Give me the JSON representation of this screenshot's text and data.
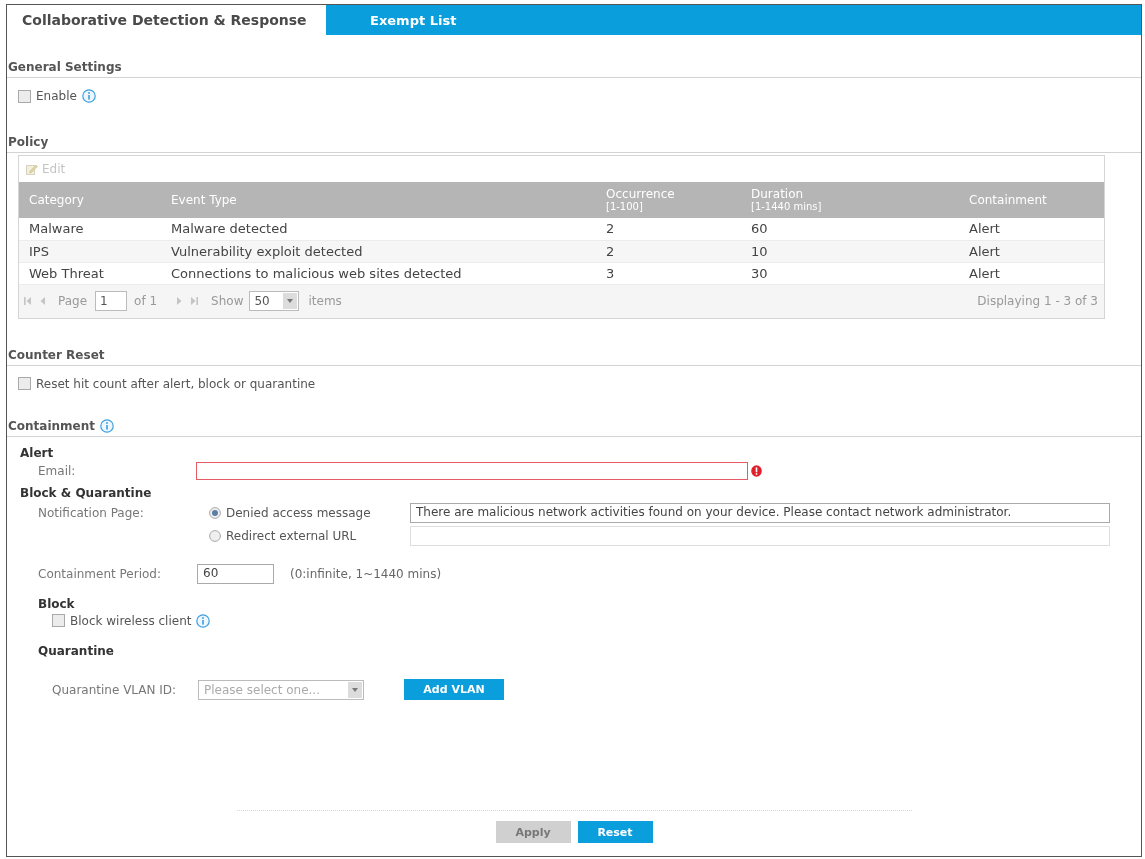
{
  "tabs": [
    {
      "label": "Collaborative Detection & Response",
      "selected": true
    },
    {
      "label": "Exempt List",
      "selected": false
    }
  ],
  "general_settings": {
    "title": "General Settings",
    "enable": {
      "label": "Enable",
      "checked": false
    }
  },
  "policy": {
    "title": "Policy",
    "edit": {
      "label": "Edit",
      "disabled": true
    },
    "table": {
      "columns": [
        {
          "label": "Category"
        },
        {
          "label": "Event Type"
        },
        {
          "label": "Occurrence",
          "range": "[1-100]"
        },
        {
          "label": "Duration",
          "range": "[1-1440 mins]"
        },
        {
          "label": "Containment"
        }
      ],
      "rows": [
        {
          "cells": [
            "Malware",
            "Malware detected",
            "2",
            "60",
            "Alert"
          ]
        },
        {
          "cells": [
            "IPS",
            "Vulnerability exploit detected",
            "2",
            "10",
            "Alert"
          ]
        },
        {
          "cells": [
            "Web Threat",
            "Connections to malicious web sites detected",
            "3",
            "30",
            "Alert"
          ]
        }
      ]
    },
    "pager": {
      "page_label": "Page",
      "page": "1",
      "page_count": "of 1",
      "show_label": "Show",
      "page_size": "50",
      "items_label": "items",
      "summary": "Displaying 1 - 3 of 3"
    }
  },
  "counter_reset": {
    "title": "Counter Reset",
    "reset_hit_count": {
      "label": "Reset hit count after alert, block or quarantine",
      "checked": false
    }
  },
  "containment": {
    "title": "Containment",
    "alert": {
      "title": "Alert",
      "email": {
        "label": "Email:",
        "invalid": true
      }
    },
    "block_quarantine": {
      "title": "Block & Quarantine",
      "notification_page": {
        "label": "Notification Page:",
        "options": [
          {
            "label": "Denied access message",
            "selected": true,
            "value": "There are malicious network activities found on your device. Please contact network administrator."
          },
          {
            "label": "Redirect external URL",
            "selected": false
          }
        ]
      },
      "containment_period": {
        "label": "Containment Period:",
        "value": "60",
        "hint": "(0:infinite, 1~1440 mins)"
      },
      "block": {
        "title": "Block",
        "block_wireless_client": {
          "label": "Block wireless client",
          "checked": false
        }
      },
      "quarantine": {
        "title": "Quarantine",
        "vlan_id": {
          "label": "Quarantine VLAN ID:",
          "placeholder": "Please select one..."
        },
        "add_vlan": {
          "label": "Add VLAN"
        }
      }
    }
  },
  "buttons": [
    {
      "label": "Apply",
      "disabled": true
    },
    {
      "label": "Reset",
      "disabled": false
    }
  ]
}
